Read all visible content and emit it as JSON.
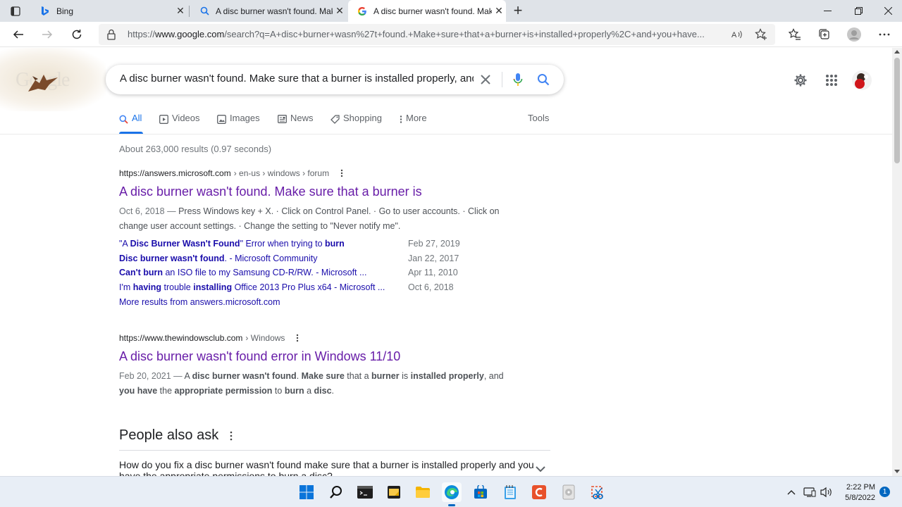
{
  "browser": {
    "tabs": [
      {
        "title": "Bing",
        "favicon": "bing-icon",
        "active": false
      },
      {
        "title": "A disc burner wasn't found. Make sure",
        "favicon": "search-icon",
        "active": false
      },
      {
        "title": "A disc burner wasn't found. Make sure",
        "favicon": "google-icon",
        "active": true
      }
    ],
    "url_prefix": "https://",
    "url_host": "www.google.com",
    "url_rest": "/search?q=A+disc+burner+wasn%27t+found.+Make+sure+that+a+burner+is+installed+properly%2C+and+you+have..."
  },
  "google": {
    "logo_text": "Google",
    "query": "A disc burner wasn't found. Make sure that a burner is installed properly, and you have",
    "tabs": [
      {
        "label": "All",
        "icon": "search-icon",
        "active": true
      },
      {
        "label": "Videos",
        "icon": "video-icon",
        "active": false
      },
      {
        "label": "Images",
        "icon": "image-icon",
        "active": false
      },
      {
        "label": "News",
        "icon": "news-icon",
        "active": false
      },
      {
        "label": "Shopping",
        "icon": "tag-icon",
        "active": false
      },
      {
        "label": "More",
        "icon": "more-vert-icon",
        "active": false
      }
    ],
    "tools_label": "Tools",
    "stats": "About 263,000 results (0.97 seconds)",
    "results": [
      {
        "cite_host": "https://answers.microsoft.com",
        "cite_path": "› en-us › windows › forum",
        "title": "A disc burner wasn't found. Make sure that a burner is",
        "snippet_date": "Oct 6, 2018 —",
        "snippet": "Press Windows key + X. · Click on Control Panel. · Go to user accounts. · Click on change user account settings. · Change the setting to \"Never notify me\".",
        "sublinks": [
          {
            "pre": "\"A ",
            "bold": "Disc Burner Wasn't Found",
            "post": "\" Error when trying to ",
            "bold2": "burn",
            "date": "Feb 27, 2019"
          },
          {
            "pre": "",
            "bold": "Disc burner wasn't found",
            "post": ". - Microsoft Community",
            "bold2": "",
            "date": "Jan 22, 2017"
          },
          {
            "pre": "",
            "bold": "Can't burn",
            "post": " an ISO file to my Samsung CD-R/RW. - Microsoft ...",
            "bold2": "",
            "date": "Apr 11, 2010"
          },
          {
            "pre": "I'm ",
            "bold": "having",
            "post": " trouble ",
            "bold2": "installing",
            "post2": " Office 2013 Pro Plus x64 - Microsoft ...",
            "date": "Oct 6, 2018"
          }
        ],
        "more_results": "More results from answers.microsoft.com"
      },
      {
        "cite_host": "https://www.thewindowsclub.com",
        "cite_path": "› Windows",
        "title": "A disc burner wasn't found error in Windows 11/10",
        "snippet_date": "Feb 20, 2021 —"
      }
    ],
    "paa_title": "People also ask",
    "paa_question": "How do you fix a disc burner wasn't found make sure that a burner is installed properly and you have the appropriate permissions to burn a disc?"
  },
  "taskbar": {
    "time": "2:22 PM",
    "date": "5/8/2022",
    "notifications": "1"
  },
  "colors": {
    "link_visited": "#681da8",
    "link": "#1a0dab",
    "accent": "#1a73e8"
  }
}
